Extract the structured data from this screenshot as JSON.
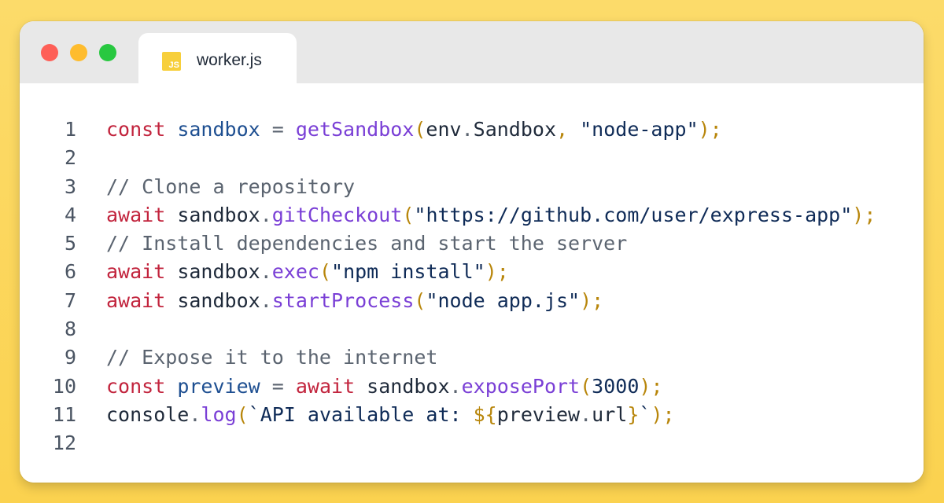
{
  "tab": {
    "title": "worker.js",
    "icon_label": "JS",
    "icon": "javascript-file-icon"
  },
  "window_controls": [
    "close-button",
    "minimize-button",
    "zoom-button"
  ],
  "colors": {
    "background": "#fbd24f",
    "keyword": "#c2243d",
    "function": "#7a3fd6",
    "variable": "#1e4f91",
    "string": "#0f2b57",
    "comment": "#5b6470",
    "punctuation": "#b8860b"
  },
  "code": {
    "line_numbers": [
      "1",
      "2",
      "3",
      "4",
      "5",
      "6",
      "7",
      "8",
      "9",
      "10",
      "11",
      "12"
    ],
    "lines": [
      [
        {
          "t": "const",
          "k": "kw"
        },
        {
          "t": " ",
          "k": "pl"
        },
        {
          "t": "sandbox",
          "k": "var"
        },
        {
          "t": " = ",
          "k": "op"
        },
        {
          "t": "getSandbox",
          "k": "fn"
        },
        {
          "t": "(",
          "k": "pu"
        },
        {
          "t": "env",
          "k": "pl"
        },
        {
          "t": ".",
          "k": "op"
        },
        {
          "t": "Sandbox",
          "k": "pl"
        },
        {
          "t": ", ",
          "k": "pu"
        },
        {
          "t": "\"node-app\"",
          "k": "str"
        },
        {
          "t": ");",
          "k": "pu"
        }
      ],
      [],
      [
        {
          "t": "// Clone a repository",
          "k": "cm"
        }
      ],
      [
        {
          "t": "await",
          "k": "kw"
        },
        {
          "t": " ",
          "k": "pl"
        },
        {
          "t": "sandbox",
          "k": "pl"
        },
        {
          "t": ".",
          "k": "op"
        },
        {
          "t": "gitCheckout",
          "k": "fn"
        },
        {
          "t": "(",
          "k": "pu"
        },
        {
          "t": "\"https://github.com/user/express-app\"",
          "k": "str"
        },
        {
          "t": ");",
          "k": "pu"
        }
      ],
      [
        {
          "t": "// Install dependencies and start the server",
          "k": "cm"
        }
      ],
      [
        {
          "t": "await",
          "k": "kw"
        },
        {
          "t": " ",
          "k": "pl"
        },
        {
          "t": "sandbox",
          "k": "pl"
        },
        {
          "t": ".",
          "k": "op"
        },
        {
          "t": "exec",
          "k": "fn"
        },
        {
          "t": "(",
          "k": "pu"
        },
        {
          "t": "\"npm install\"",
          "k": "str"
        },
        {
          "t": ");",
          "k": "pu"
        }
      ],
      [
        {
          "t": "await",
          "k": "kw"
        },
        {
          "t": " ",
          "k": "pl"
        },
        {
          "t": "sandbox",
          "k": "pl"
        },
        {
          "t": ".",
          "k": "op"
        },
        {
          "t": "startProcess",
          "k": "fn"
        },
        {
          "t": "(",
          "k": "pu"
        },
        {
          "t": "\"node app.js\"",
          "k": "str"
        },
        {
          "t": ");",
          "k": "pu"
        }
      ],
      [],
      [
        {
          "t": "// Expose it to the internet",
          "k": "cm"
        }
      ],
      [
        {
          "t": "const",
          "k": "kw"
        },
        {
          "t": " ",
          "k": "pl"
        },
        {
          "t": "preview",
          "k": "var"
        },
        {
          "t": " = ",
          "k": "op"
        },
        {
          "t": "await",
          "k": "kw"
        },
        {
          "t": " ",
          "k": "pl"
        },
        {
          "t": "sandbox",
          "k": "pl"
        },
        {
          "t": ".",
          "k": "op"
        },
        {
          "t": "exposePort",
          "k": "fn"
        },
        {
          "t": "(",
          "k": "pu"
        },
        {
          "t": "3000",
          "k": "str"
        },
        {
          "t": ");",
          "k": "pu"
        }
      ],
      [
        {
          "t": "console",
          "k": "pl"
        },
        {
          "t": ".",
          "k": "op"
        },
        {
          "t": "log",
          "k": "fn"
        },
        {
          "t": "(",
          "k": "pu"
        },
        {
          "t": "`API available at: ",
          "k": "str"
        },
        {
          "t": "${",
          "k": "pu"
        },
        {
          "t": "preview",
          "k": "pl"
        },
        {
          "t": ".",
          "k": "op"
        },
        {
          "t": "url",
          "k": "pl"
        },
        {
          "t": "}",
          "k": "pu"
        },
        {
          "t": "`",
          "k": "str"
        },
        {
          "t": ");",
          "k": "pu"
        }
      ],
      []
    ]
  }
}
